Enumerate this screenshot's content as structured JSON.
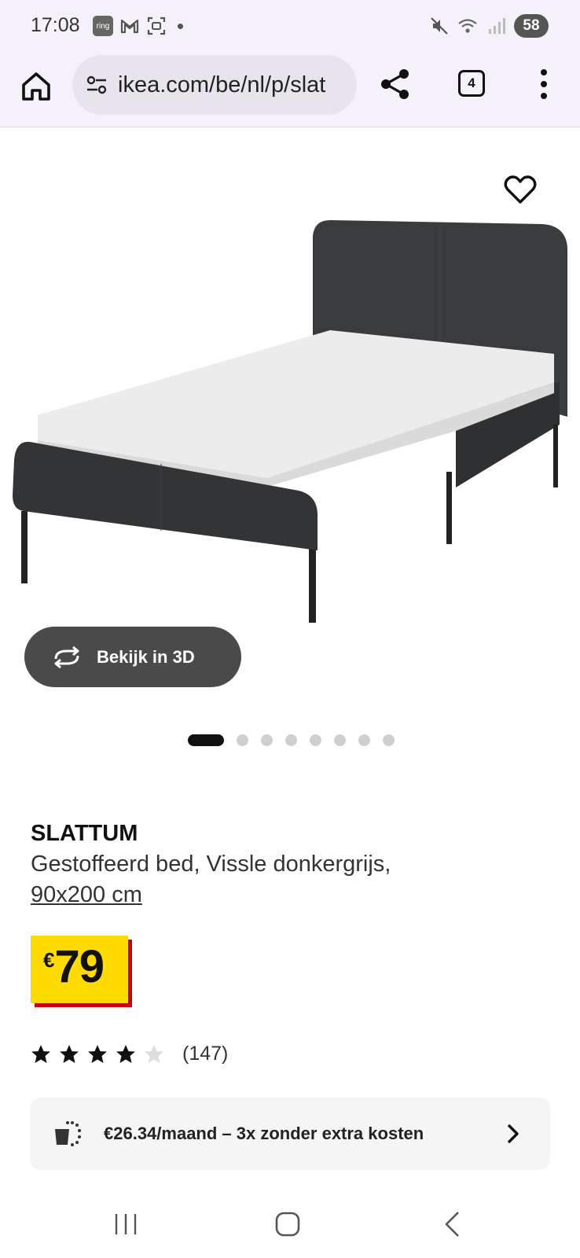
{
  "status_bar": {
    "time": "17:08",
    "left_icons": [
      "ring-app-icon",
      "gmail-icon",
      "screenshot-icon",
      "notification-dot"
    ],
    "ring_badge_text": "ring",
    "right_icons": [
      "mute-icon",
      "wifi-icon",
      "signal-icon"
    ],
    "battery": "58"
  },
  "browser": {
    "url": "ikea.com/be/nl/p/slat",
    "tab_count": "4",
    "icons": [
      "home-icon",
      "site-settings-icon",
      "share-icon",
      "tabs-icon",
      "more-menu-icon"
    ]
  },
  "gallery": {
    "view_3d_label": "Bekijk in 3D",
    "slide_count": 8,
    "active_slide": 0,
    "wishlist_icon": "heart-icon"
  },
  "product": {
    "name": "SLATTUM",
    "description": "Gestoffeerd bed, Vissle donkergrijs,",
    "size": "90x200 cm",
    "price_currency": "€",
    "price_value": "79",
    "rating_value": 4,
    "rating_max": 5,
    "review_count": "(147)"
  },
  "installment": {
    "text": "€26.34/maand – 3x zonder extra kosten"
  },
  "colors": {
    "price_yellow": "#ffdb00",
    "price_red": "#cc0008",
    "button_dark": "#4a4a4a",
    "chrome_bg": "#f4f1f8"
  },
  "nav_bar": {
    "icons": [
      "recent-apps-icon",
      "home-button-icon",
      "back-icon"
    ]
  }
}
